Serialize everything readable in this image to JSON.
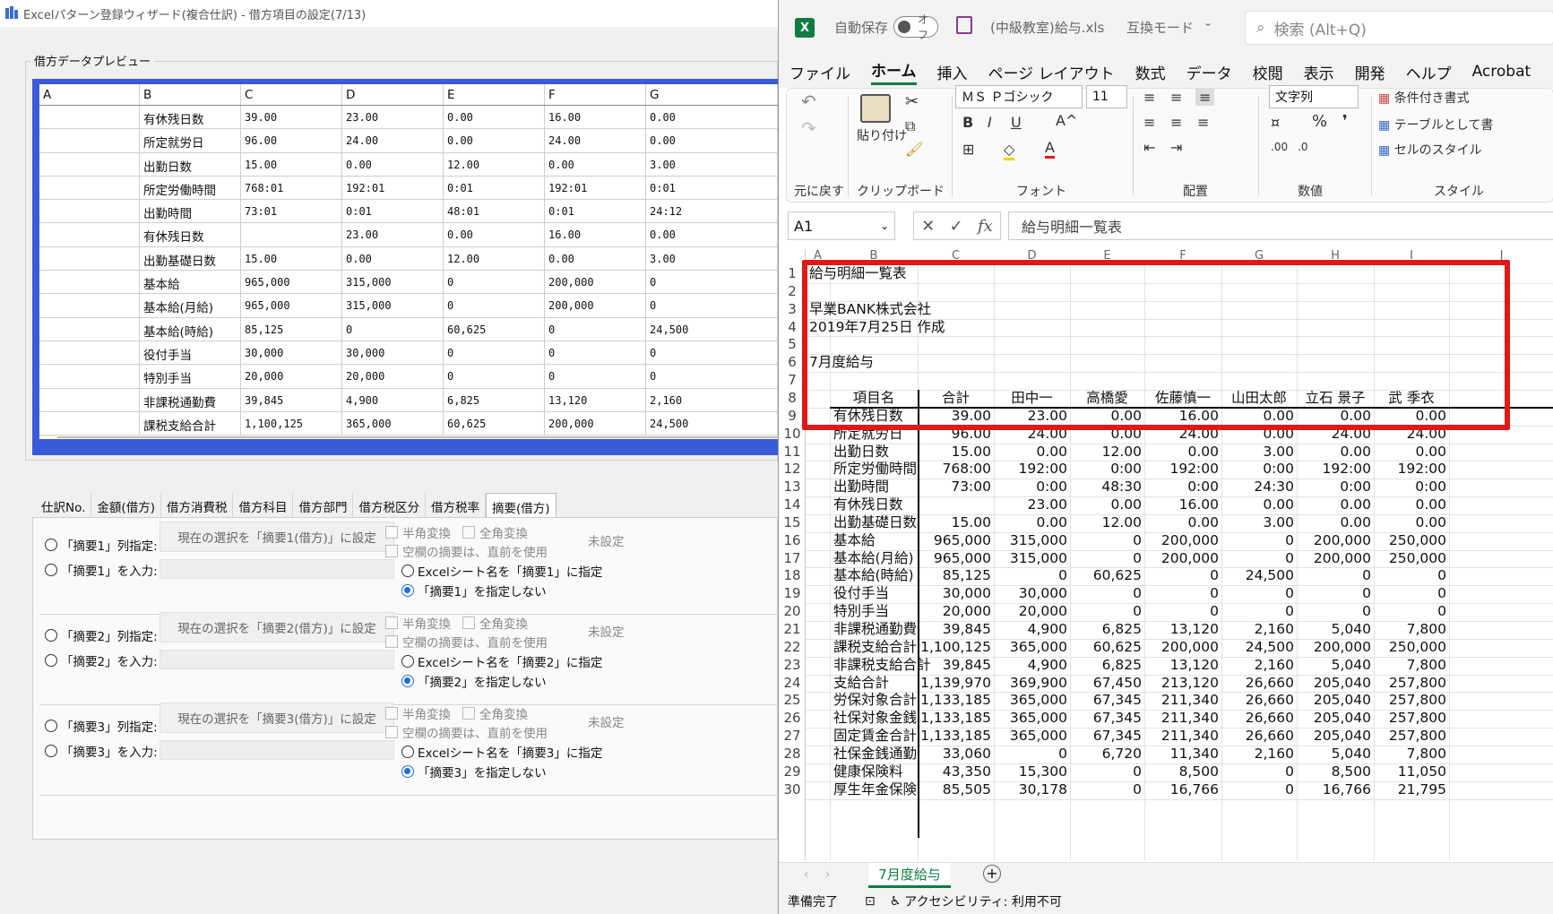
{
  "wizard": {
    "title": "Excelパターン登録ウィザード(複合仕訳) - 借方項目の設定(7/13)",
    "group_title": "借方データプレビュー",
    "preview_headers": [
      "A",
      "B",
      "C",
      "D",
      "E",
      "F",
      "G"
    ],
    "preview_rows": [
      [
        "",
        "有休残日数",
        "39.00",
        "23.00",
        "0.00",
        "16.00",
        "0.00"
      ],
      [
        "",
        "所定就労日",
        "96.00",
        "24.00",
        "0.00",
        "24.00",
        "0.00"
      ],
      [
        "",
        "出勤日数",
        "15.00",
        "0.00",
        "12.00",
        "0.00",
        "3.00"
      ],
      [
        "",
        "所定労働時間",
        "768:01",
        "192:01",
        "0:01",
        "192:01",
        "0:01"
      ],
      [
        "",
        "出勤時間",
        "73:01",
        "0:01",
        "48:01",
        "0:01",
        "24:12"
      ],
      [
        "",
        "有休残日数",
        "",
        "23.00",
        "0.00",
        "16.00",
        "0.00"
      ],
      [
        "",
        "出勤基礎日数",
        "15.00",
        "0.00",
        "12.00",
        "0.00",
        "3.00"
      ],
      [
        "",
        "基本給",
        "965,000",
        "315,000",
        "0",
        "200,000",
        "0"
      ],
      [
        "",
        "基本給(月給)",
        "965,000",
        "315,000",
        "0",
        "200,000",
        "0"
      ],
      [
        "",
        "基本給(時給)",
        "85,125",
        "0",
        "60,625",
        "0",
        "24,500"
      ],
      [
        "",
        "役付手当",
        "30,000",
        "30,000",
        "0",
        "0",
        "0"
      ],
      [
        "",
        "特別手当",
        "20,000",
        "20,000",
        "0",
        "0",
        "0"
      ],
      [
        "",
        "非課税通勤費",
        "39,845",
        "4,900",
        "6,825",
        "13,120",
        "2,160"
      ],
      [
        "",
        "課税支給合計",
        "1,100,125",
        "365,000",
        "60,625",
        "200,000",
        "24,500"
      ]
    ],
    "tabs": [
      "仕訳No.",
      "金額(借方)",
      "借方消費税",
      "借方科目",
      "借方部門",
      "借方税区分",
      "借方税率",
      "摘要(借方)"
    ],
    "blocks": [
      {
        "col_label": "「摘要1」列指定:",
        "input_label": "「摘要1」を入力:",
        "button": "現在の選択を「摘要1(借方)」に設定",
        "half": "半角変換",
        "full": "全角変換",
        "blank": "空欄の摘要は、直前を使用",
        "sheet_opt": "Excelシート名を「摘要1」に指定",
        "none_opt": "「摘要1」を指定しない",
        "status": "未設定"
      },
      {
        "col_label": "「摘要2」列指定:",
        "input_label": "「摘要2」を入力:",
        "button": "現在の選択を「摘要2(借方)」に設定",
        "half": "半角変換",
        "full": "全角変換",
        "blank": "空欄の摘要は、直前を使用",
        "sheet_opt": "Excelシート名を「摘要2」に指定",
        "none_opt": "「摘要2」を指定しない",
        "status": "未設定"
      },
      {
        "col_label": "「摘要3」列指定:",
        "input_label": "「摘要3」を入力:",
        "button": "現在の選択を「摘要3(借方)」に設定",
        "half": "半角変換",
        "full": "全角変換",
        "blank": "空欄の摘要は、直前を使用",
        "sheet_opt": "Excelシート名を「摘要3」に指定",
        "none_opt": "「摘要3」を指定しない",
        "status": "未設定"
      }
    ]
  },
  "excel": {
    "autosave": "自動保存",
    "toggle": "オフ",
    "filename": "(中級教室)給与.xls",
    "mode": "互換モード",
    "search": "検索 (Alt+Q)",
    "menu": [
      "ファイル",
      "ホーム",
      "挿入",
      "ページ レイアウト",
      "数式",
      "データ",
      "校閲",
      "表示",
      "開発",
      "ヘルプ",
      "Acrobat"
    ],
    "ribbon": {
      "undo_group": "元に戻す",
      "paste": "貼り付け",
      "clipboard": "クリップボード",
      "font": "ＭＳ Ｐゴシック",
      "font_size": "11",
      "font_group": "フォント",
      "align_group": "配置",
      "number_format": "文字列",
      "number_group": "数値",
      "cond_format": "条件付き書式",
      "table_format": "テーブルとして書",
      "cell_style": "セルのスタイル",
      "style_group": "スタイル"
    },
    "namebox": "A1",
    "formula": "給与明細一覧表",
    "col_letters": [
      "A",
      "B",
      "C",
      "D",
      "E",
      "F",
      "G",
      "H",
      "I",
      "J"
    ],
    "text_rows": [
      {
        "n": "1",
        "t": "給与明細一覧表"
      },
      {
        "n": "2",
        "t": ""
      },
      {
        "n": "3",
        "t": "早業BANK株式会社"
      },
      {
        "n": "4",
        "t": "2019年7月25日 作成"
      },
      {
        "n": "5",
        "t": ""
      },
      {
        "n": "6",
        "t": "7月度給与"
      },
      {
        "n": "7",
        "t": ""
      }
    ],
    "header_row": {
      "n": "8",
      "cells": [
        "項目名",
        "合計",
        "田中一",
        "高橋愛",
        "佐藤慎一",
        "山田太郎",
        "立石 景子",
        "武 季衣"
      ]
    },
    "data_rows": [
      {
        "n": "9",
        "cells": [
          "有休残日数",
          "39.00",
          "23.00",
          "0.00",
          "16.00",
          "0.00",
          "0.00",
          "0.00"
        ]
      },
      {
        "n": "10",
        "cells": [
          "所定就労日",
          "96.00",
          "24.00",
          "0.00",
          "24.00",
          "0.00",
          "24.00",
          "24.00"
        ]
      },
      {
        "n": "11",
        "cells": [
          "出勤日数",
          "15.00",
          "0.00",
          "12.00",
          "0.00",
          "3.00",
          "0.00",
          "0.00"
        ]
      },
      {
        "n": "12",
        "cells": [
          "所定労働時間",
          "768:00",
          "192:00",
          "0:00",
          "192:00",
          "0:00",
          "192:00",
          "192:00"
        ]
      },
      {
        "n": "13",
        "cells": [
          "出勤時間",
          "73:00",
          "0:00",
          "48:30",
          "0:00",
          "24:30",
          "0:00",
          "0:00"
        ]
      },
      {
        "n": "14",
        "cells": [
          "有休残日数",
          "",
          "23.00",
          "0.00",
          "16.00",
          "0.00",
          "0.00",
          "0.00"
        ]
      },
      {
        "n": "15",
        "cells": [
          "出勤基礎日数",
          "15.00",
          "0.00",
          "12.00",
          "0.00",
          "3.00",
          "0.00",
          "0.00"
        ]
      },
      {
        "n": "16",
        "cells": [
          "基本給",
          "965,000",
          "315,000",
          "0",
          "200,000",
          "0",
          "200,000",
          "250,000"
        ]
      },
      {
        "n": "17",
        "cells": [
          "基本給(月給)",
          "965,000",
          "315,000",
          "0",
          "200,000",
          "0",
          "200,000",
          "250,000"
        ]
      },
      {
        "n": "18",
        "cells": [
          "基本給(時給)",
          "85,125",
          "0",
          "60,625",
          "0",
          "24,500",
          "0",
          "0"
        ]
      },
      {
        "n": "19",
        "cells": [
          "役付手当",
          "30,000",
          "30,000",
          "0",
          "0",
          "0",
          "0",
          "0"
        ]
      },
      {
        "n": "20",
        "cells": [
          "特別手当",
          "20,000",
          "20,000",
          "0",
          "0",
          "0",
          "0",
          "0"
        ]
      },
      {
        "n": "21",
        "cells": [
          "非課税通勤費",
          "39,845",
          "4,900",
          "6,825",
          "13,120",
          "2,160",
          "5,040",
          "7,800"
        ]
      },
      {
        "n": "22",
        "cells": [
          "課税支給合計",
          "1,100,125",
          "365,000",
          "60,625",
          "200,000",
          "24,500",
          "200,000",
          "250,000"
        ]
      },
      {
        "n": "23",
        "cells": [
          "非課税支給合計",
          "39,845",
          "4,900",
          "6,825",
          "13,120",
          "2,160",
          "5,040",
          "7,800"
        ]
      },
      {
        "n": "24",
        "cells": [
          "支給合計",
          "1,139,970",
          "369,900",
          "67,450",
          "213,120",
          "26,660",
          "205,040",
          "257,800"
        ]
      },
      {
        "n": "25",
        "cells": [
          "労保対象合計",
          "1,133,185",
          "365,000",
          "67,345",
          "211,340",
          "26,660",
          "205,040",
          "257,800"
        ]
      },
      {
        "n": "26",
        "cells": [
          "社保対象金銭",
          "1,133,185",
          "365,000",
          "67,345",
          "211,340",
          "26,660",
          "205,040",
          "257,800"
        ]
      },
      {
        "n": "27",
        "cells": [
          "固定賃金合計",
          "1,133,185",
          "365,000",
          "67,345",
          "211,340",
          "26,660",
          "205,040",
          "257,800"
        ]
      },
      {
        "n": "28",
        "cells": [
          "社保金銭通勤",
          "33,060",
          "0",
          "6,720",
          "11,340",
          "2,160",
          "5,040",
          "7,800"
        ]
      },
      {
        "n": "29",
        "cells": [
          "健康保険料",
          "43,350",
          "15,300",
          "0",
          "8,500",
          "0",
          "8,500",
          "11,050"
        ]
      },
      {
        "n": "30",
        "cells": [
          "厚生年金保険",
          "85,505",
          "30,178",
          "0",
          "16,766",
          "0",
          "16,766",
          "21,795"
        ]
      }
    ],
    "sheet_tab": "7月度給与",
    "status_ready": "準備完了",
    "status_access": "アクセシビリティ: 利用不可",
    "accent": "#107c41",
    "highlight": "#e01818"
  }
}
